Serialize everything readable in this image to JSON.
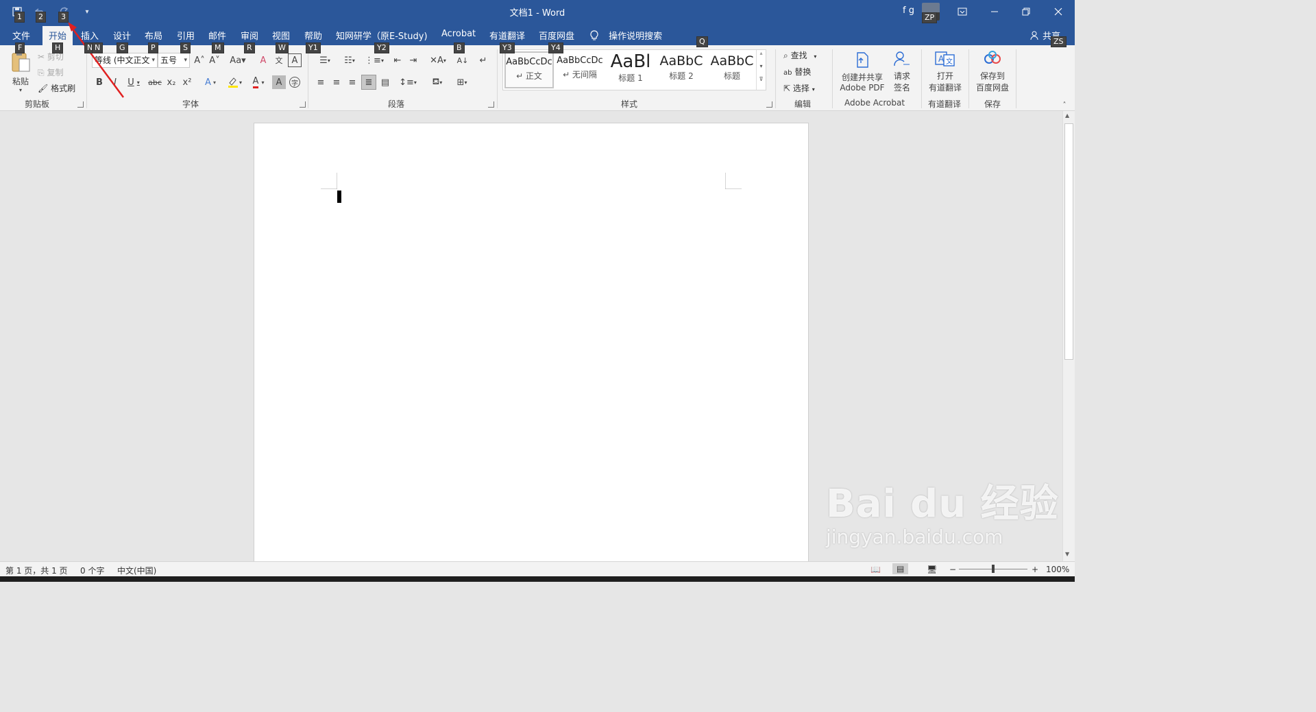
{
  "titlebar": {
    "doc_title": "文档1  -  Word",
    "user_name": "f g",
    "avatar_initials": "ZP",
    "qat_keytips": [
      "1",
      "2",
      "3"
    ]
  },
  "tabs": [
    {
      "label": "文件",
      "keytip": "F"
    },
    {
      "label": "开始",
      "keytip": "H"
    },
    {
      "label": "插入",
      "keytip": "N"
    },
    {
      "label": "设计",
      "keytip": "G"
    },
    {
      "label": "布局",
      "keytip": "P"
    },
    {
      "label": "引用",
      "keytip": "S"
    },
    {
      "label": "邮件",
      "keytip": "M"
    },
    {
      "label": "审阅",
      "keytip": "R"
    },
    {
      "label": "视图",
      "keytip": "W"
    },
    {
      "label": "帮助",
      "keytip": "Y1"
    },
    {
      "label": "知网研学（原E-Study)",
      "keytip": "Y2"
    },
    {
      "label": "Acrobat",
      "keytip": "B"
    },
    {
      "label": "有道翻译",
      "keytip": "Y3"
    },
    {
      "label": "百度网盘",
      "keytip": "Y4"
    },
    {
      "label": "操作说明搜索",
      "keytip": "Q"
    }
  ],
  "share": {
    "label": "共享",
    "keytip": "ZS"
  },
  "clipboard": {
    "paste": "粘贴",
    "cut": "剪切",
    "copy": "复制",
    "format_painter": "格式刷",
    "group": "剪贴板"
  },
  "font": {
    "font_name": "等线 (中文正文",
    "font_size": "五号",
    "group": "字体"
  },
  "paragraph": {
    "group": "段落"
  },
  "styles": {
    "items": [
      {
        "preview": "AaBbCcDc",
        "name": "↵ 正文"
      },
      {
        "preview": "AaBbCcDc",
        "name": "↵ 无间隔"
      },
      {
        "preview": "AaBl",
        "name": "标题 1"
      },
      {
        "preview": "AaBbC",
        "name": "标题 2"
      },
      {
        "preview": "AaBbC",
        "name": "标题"
      }
    ],
    "group": "样式"
  },
  "editing": {
    "find": "查找",
    "replace": "替换",
    "select": "选择",
    "group": "编辑"
  },
  "acrobat": {
    "create_share_l1": "创建并共享",
    "create_share_l2": "Adobe PDF",
    "request_sign_l1": "请求",
    "request_sign_l2": "签名",
    "group": "Adobe Acrobat"
  },
  "youdao": {
    "open_l1": "打开",
    "open_l2": "有道翻译",
    "group": "有道翻译"
  },
  "baidu": {
    "save_l1": "保存到",
    "save_l2": "百度网盘",
    "group": "保存"
  },
  "status": {
    "page": "第 1 页，共 1 页",
    "words": "0 个字",
    "language": "中文(中国)",
    "zoom": "100%"
  },
  "watermark": {
    "logo": "Bai du 经验",
    "url": "jingyan.baidu.com"
  },
  "colors": {
    "title_bar": "#2b579a",
    "ribbon_bg": "#f3f3f3",
    "annotation": "#e02020"
  }
}
